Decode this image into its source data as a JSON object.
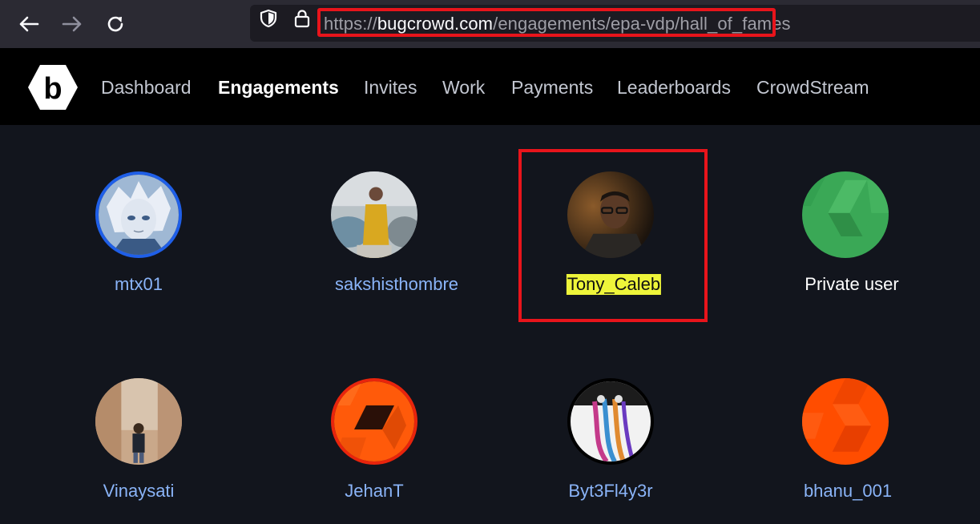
{
  "browser": {
    "url_prefix": "https://",
    "url_host": "bugcrowd.com",
    "url_path": "/engagements/epa-vdp/hall_of_fames",
    "icons": [
      "back-arrow-icon",
      "forward-arrow-icon",
      "reload-icon",
      "shield-icon",
      "lock-icon"
    ]
  },
  "site": {
    "logo_letter": "b",
    "nav": [
      {
        "label": "Dashboard",
        "active": false
      },
      {
        "label": "Engagements",
        "active": true
      },
      {
        "label": "Invites",
        "active": false
      },
      {
        "label": "Work",
        "active": false
      },
      {
        "label": "Payments",
        "active": false
      },
      {
        "label": "Leaderboards",
        "active": false
      },
      {
        "label": "CrowdStream",
        "active": false
      }
    ]
  },
  "hall_of_fame": {
    "members": [
      {
        "name": "mtx01",
        "ring": "#1f5fe8"
      },
      {
        "name": "sakshisthombre"
      },
      {
        "name": "Tony_Caleb",
        "highlighted": true
      },
      {
        "name": "Private user",
        "private": true
      },
      {
        "name": "Vinaysati"
      },
      {
        "name": "JehanT",
        "ring": "#e8240c"
      },
      {
        "name": "Byt3Fl4y3r",
        "ring": "#000000"
      },
      {
        "name": "bhanu_001"
      }
    ]
  },
  "colors": {
    "annotation_red": "#e8141b",
    "highlight_yellow": "#eef53a",
    "link_blue": "#8ab4f8"
  }
}
